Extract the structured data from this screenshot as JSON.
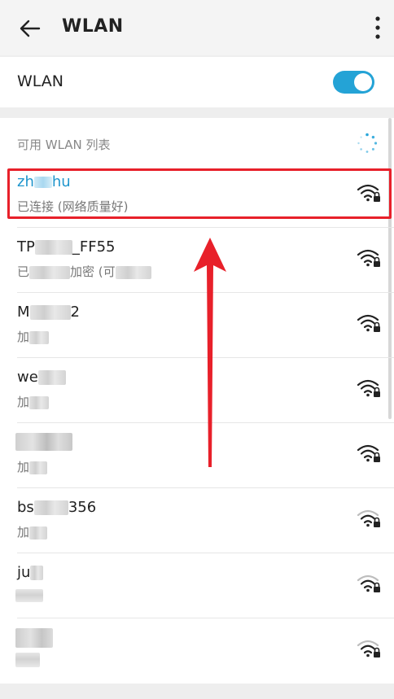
{
  "header": {
    "title": "WLAN",
    "back_icon": "back-arrow-icon",
    "more_icon": "more-vertical-icon"
  },
  "wlan": {
    "label": "WLAN",
    "toggle_on": true,
    "accent": "#24a3d6"
  },
  "list": {
    "header": "可用 WLAN 列表",
    "networks": [
      {
        "name_a": "zh",
        "name_b": "hu",
        "status": "已连接 (网络质量好)",
        "connected": true
      },
      {
        "name_a": "TP",
        "name_b": "_FF55",
        "status_a": "已",
        "status_b": "加密 (可"
      },
      {
        "name_a": "M",
        "name_b": "2",
        "status_a": "加"
      },
      {
        "name_a": "we",
        "status_a": "加"
      },
      {
        "status_a": "加"
      },
      {
        "name_a": "bs",
        "name_b": "356",
        "status_a": "加"
      },
      {
        "name_a": "ju"
      },
      {}
    ]
  },
  "colors": {
    "highlight": "#e8202a",
    "connected_text": "#2096cd"
  }
}
